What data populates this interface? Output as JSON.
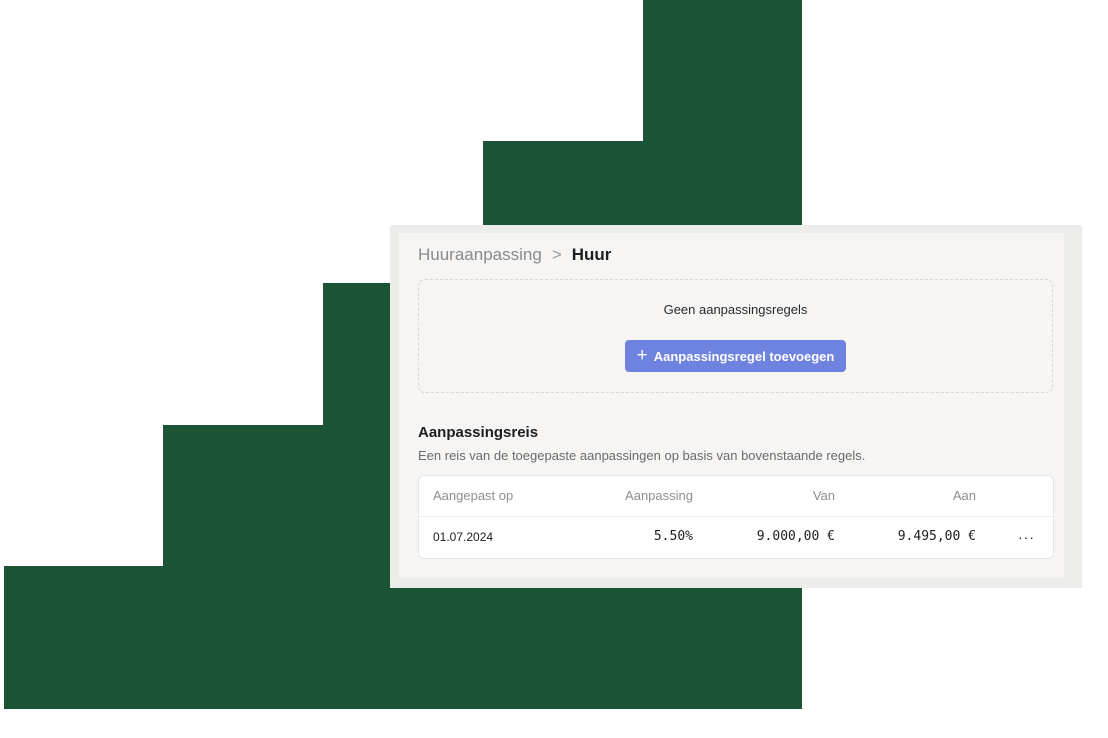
{
  "breadcrumb": {
    "parent": "Huuraanpassing",
    "current": "Huur"
  },
  "rules": {
    "empty_text": "Geen aanpassingsregels",
    "add_button_label": "Aanpassingsregel toevoegen"
  },
  "journey": {
    "title": "Aanpassingsreis",
    "subtitle": "Een reis van de toegepaste aanpassingen op basis van bovenstaande regels.",
    "columns": [
      "Aangepast op",
      "Aanpassing",
      "Van",
      "Aan"
    ],
    "rows": [
      {
        "date": "01.07.2024",
        "adjustment": "5.50%",
        "from": "9.000,00 €",
        "to": "9.495,00 €"
      }
    ]
  },
  "icons": {
    "breadcrumb_separator": "chevron-right-icon",
    "add": "plus-icon",
    "row_menu": "more-horizontal-icon"
  },
  "colors": {
    "background_shape": "#1b5434",
    "primary_button": "#6e82e0"
  }
}
